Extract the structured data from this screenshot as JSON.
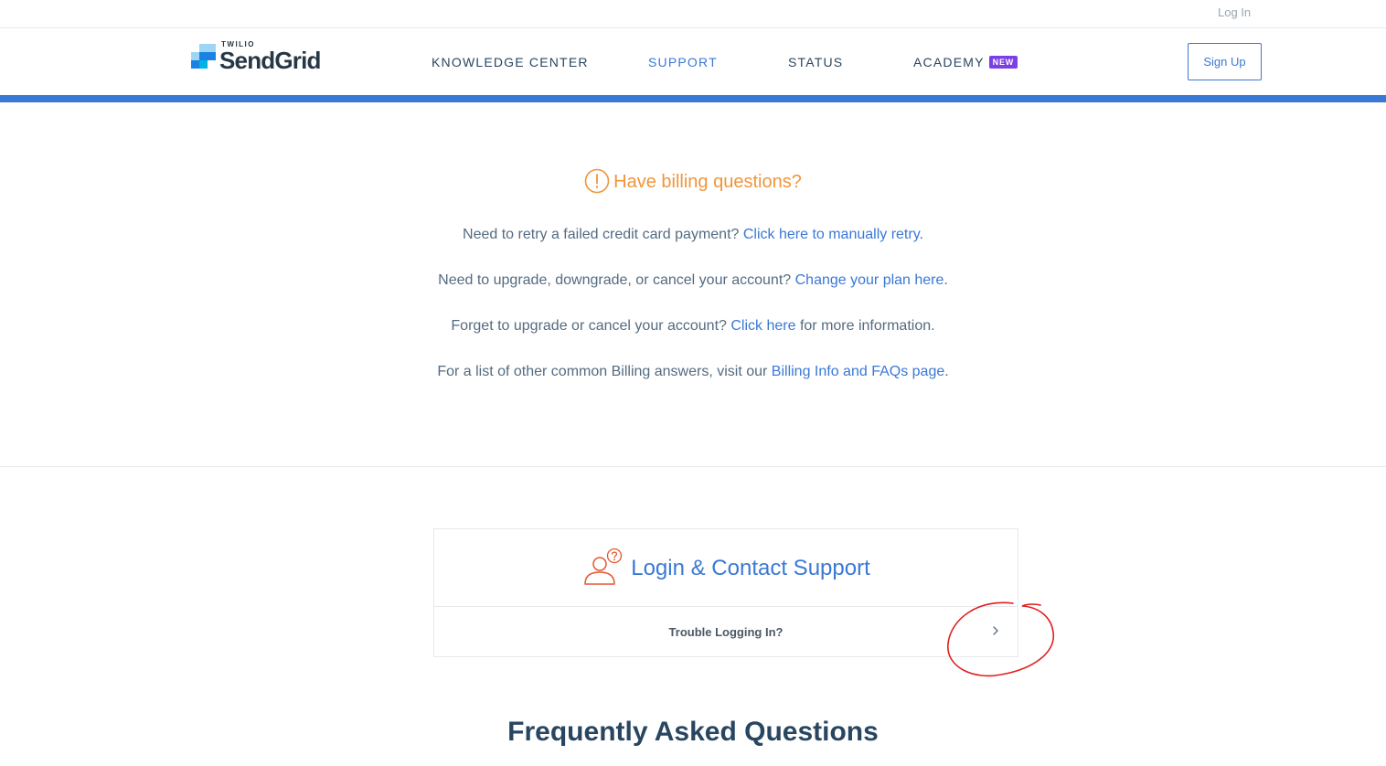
{
  "utility": {
    "login_label": "Log In"
  },
  "header": {
    "logo_small": "TWILIO",
    "logo_text": "SendGrid",
    "nav": [
      {
        "label": "KNOWLEDGE CENTER",
        "active": false
      },
      {
        "label": "SUPPORT",
        "active": true
      },
      {
        "label": "STATUS",
        "active": false
      },
      {
        "label": "ACADEMY",
        "active": false,
        "badge": "NEW"
      }
    ],
    "signup_label": "Sign Up",
    "accent_color": "#3a78d6"
  },
  "billing": {
    "heading": "Have billing questions?",
    "heading_icon": "alert-circle-icon",
    "heading_color": "#f0953b",
    "lines": [
      {
        "before": "Need to retry a failed credit card payment? ",
        "link": "Click here to manually retry",
        "after": "."
      },
      {
        "before": "Need to upgrade, downgrade, or cancel your account? ",
        "link": "Change your plan here",
        "after": "."
      },
      {
        "before": "Forget to upgrade or cancel your account? ",
        "link": "Click here",
        "after": " for more information."
      },
      {
        "before": "For a list of other common Billing answers, visit our ",
        "link": "Billing Info and FAQs page",
        "after": "."
      }
    ]
  },
  "support_card": {
    "icon": "user-question-icon",
    "title": "Login & Contact Support",
    "row_label": "Trouble Logging In?",
    "row_icon": "chevron-right-icon"
  },
  "faq": {
    "title": "Frequently Asked Questions"
  }
}
